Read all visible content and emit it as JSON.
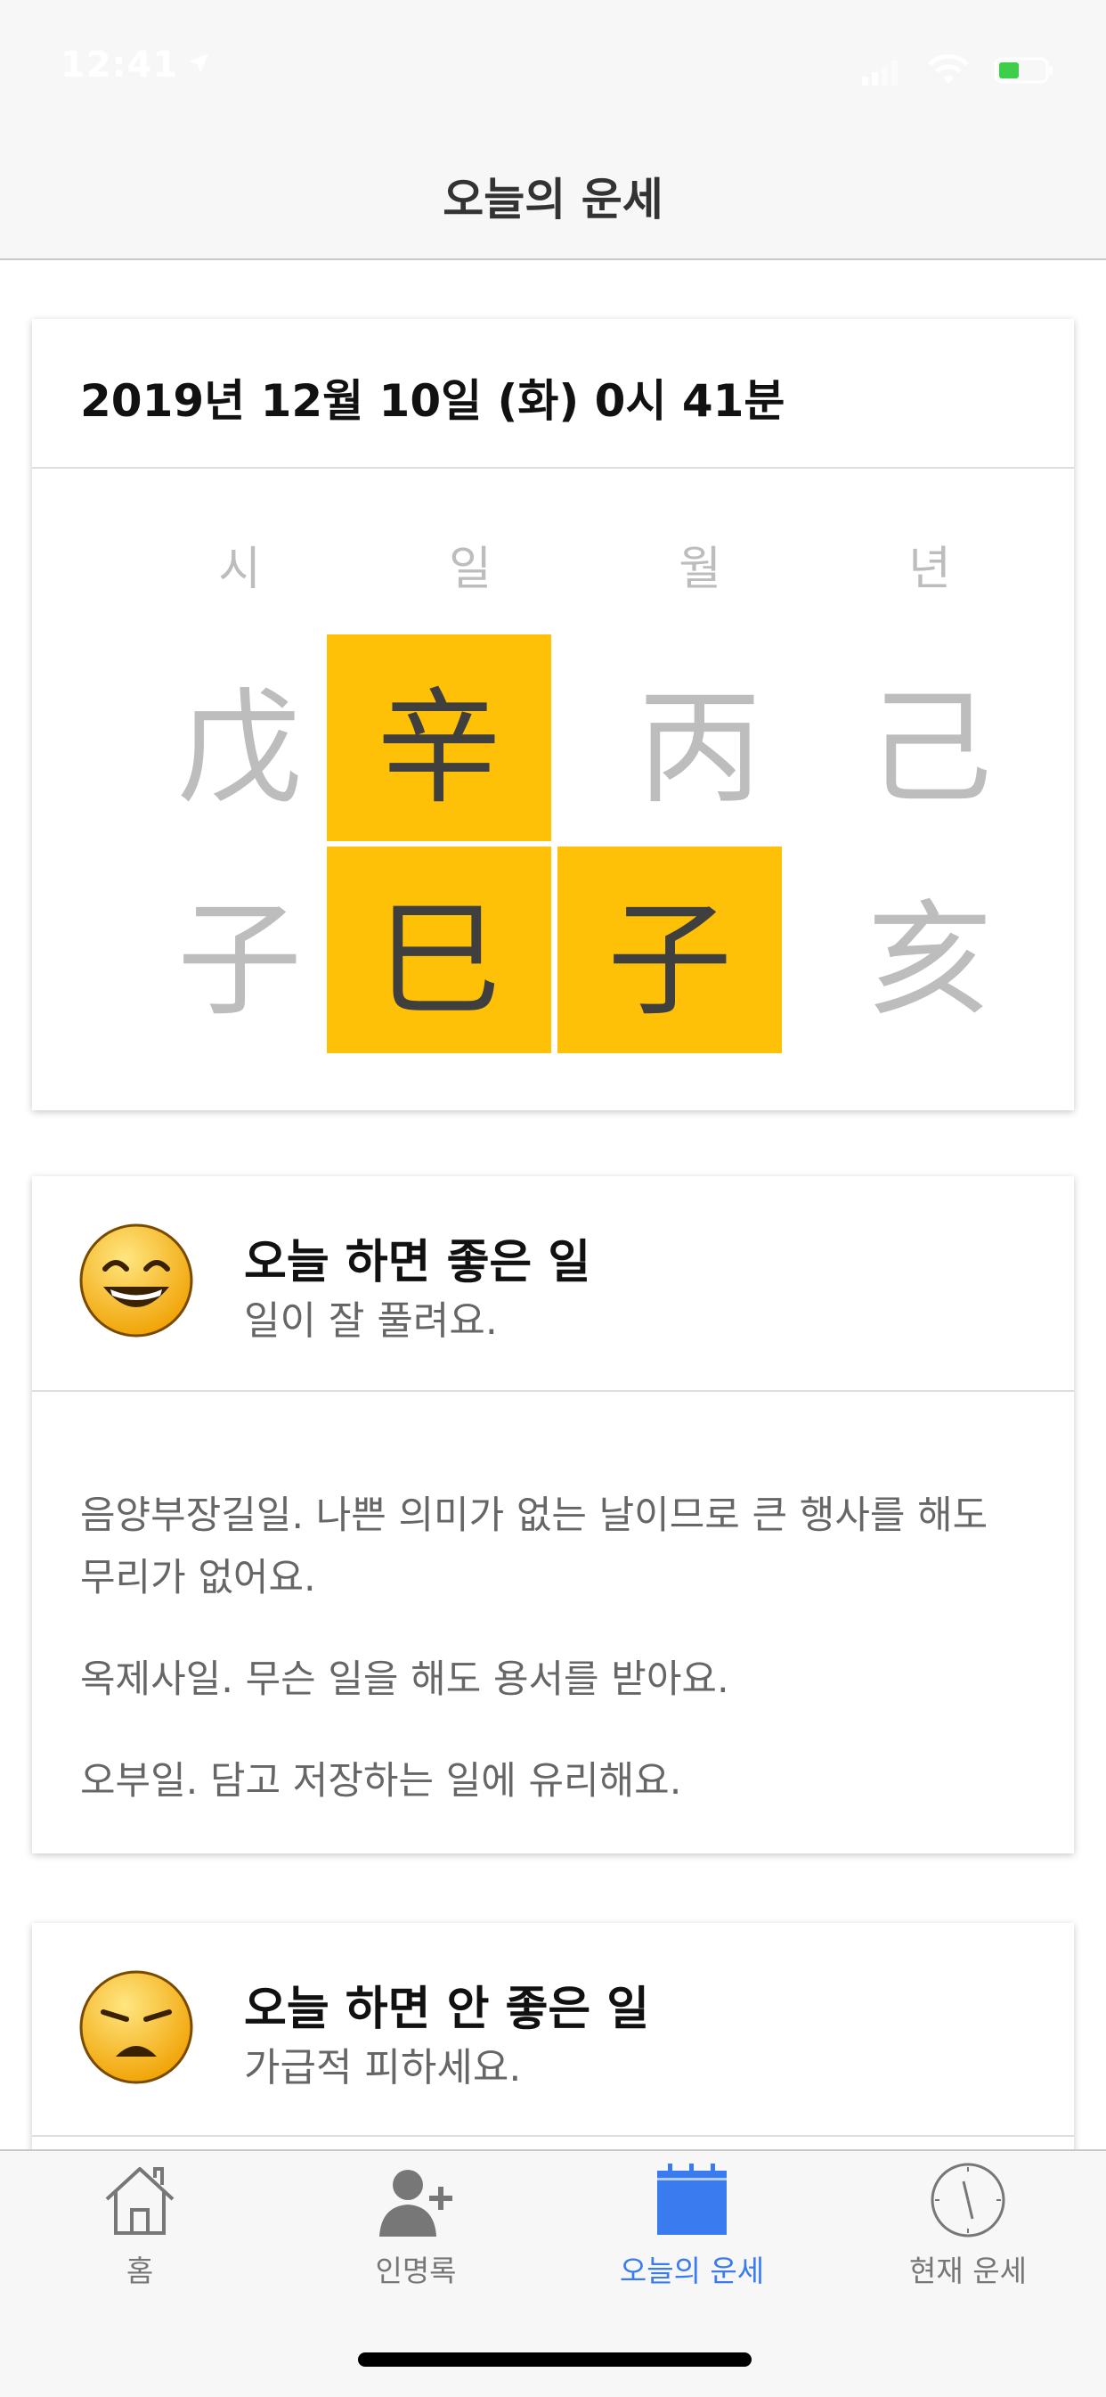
{
  "status_bar": {
    "time": "12:41"
  },
  "nav": {
    "title": "오늘의 운세"
  },
  "saju": {
    "date": "2019년 12월 10일 (화) 0시 41분",
    "columns": [
      "시",
      "일",
      "월",
      "년"
    ],
    "top_row": [
      "戊",
      "辛",
      "丙",
      "己"
    ],
    "bottom_row": [
      "子",
      "巳",
      "子",
      "亥"
    ],
    "highlight_color": "#ffc107"
  },
  "good_card": {
    "title": "오늘 하면 좋은 일",
    "subtitle": "일이 잘 풀려요.",
    "paragraphs": [
      "음양부장길일. 나쁜 의미가 없는 날이므로 큰 행사를 해도 무리가 없어요.",
      "옥제사일. 무슨 일을 해도 용서를 받아요.",
      "오부일. 담고 저장하는 일에 유리해요."
    ]
  },
  "bad_card": {
    "title": "오늘 하면 안 좋은 일",
    "subtitle": "가급적 피하세요."
  },
  "tabs": [
    {
      "label": "홈",
      "icon": "home-icon"
    },
    {
      "label": "인명록",
      "icon": "add-person-icon"
    },
    {
      "label": "오늘의 운세",
      "icon": "calendar-icon",
      "active": true
    },
    {
      "label": "현재 운세",
      "icon": "clock-icon"
    }
  ],
  "accent_color": "#3a7bf0"
}
